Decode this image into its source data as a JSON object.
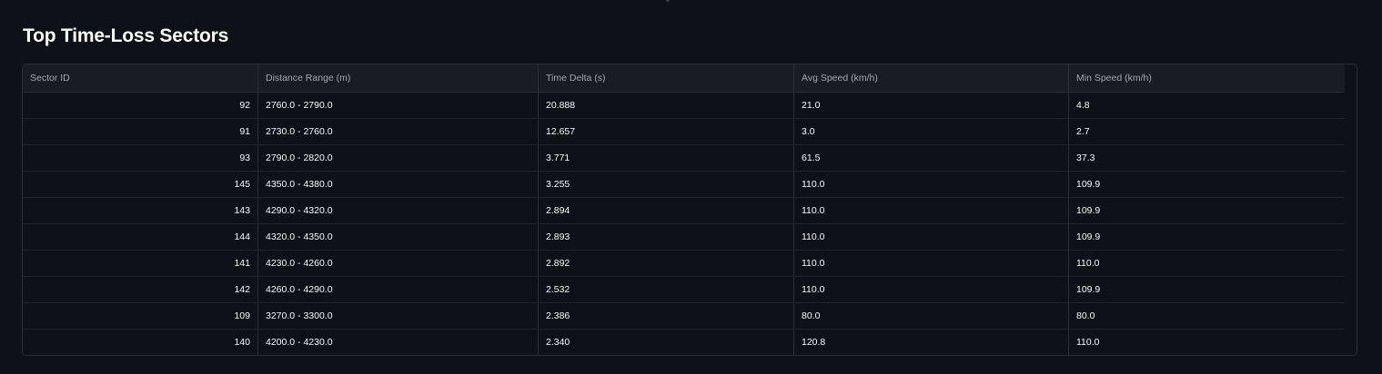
{
  "title": "Top Time-Loss Sectors",
  "table": {
    "columns": [
      "Sector ID",
      "Distance Range (m)",
      "Time Delta (s)",
      "Avg Speed (km/h)",
      "Min Speed (km/h)"
    ],
    "rows": [
      [
        "92",
        "2760.0 - 2790.0",
        "20.888",
        "21.0",
        "4.8"
      ],
      [
        "91",
        "2730.0 - 2760.0",
        "12.657",
        "3.0",
        "2.7"
      ],
      [
        "93",
        "2790.0 - 2820.0",
        "3.771",
        "61.5",
        "37.3"
      ],
      [
        "145",
        "4350.0 - 4380.0",
        "3.255",
        "110.0",
        "109.9"
      ],
      [
        "143",
        "4290.0 - 4320.0",
        "2.894",
        "110.0",
        "109.9"
      ],
      [
        "144",
        "4320.0 - 4350.0",
        "2.893",
        "110.0",
        "109.9"
      ],
      [
        "141",
        "4230.0 - 4260.0",
        "2.892",
        "110.0",
        "110.0"
      ],
      [
        "142",
        "4260.0 - 4290.0",
        "2.532",
        "110.0",
        "109.9"
      ],
      [
        "109",
        "3270.0 - 3300.0",
        "2.386",
        "80.0",
        "80.0"
      ],
      [
        "140",
        "4200.0 - 4230.0",
        "2.340",
        "120.8",
        "110.0"
      ]
    ]
  }
}
